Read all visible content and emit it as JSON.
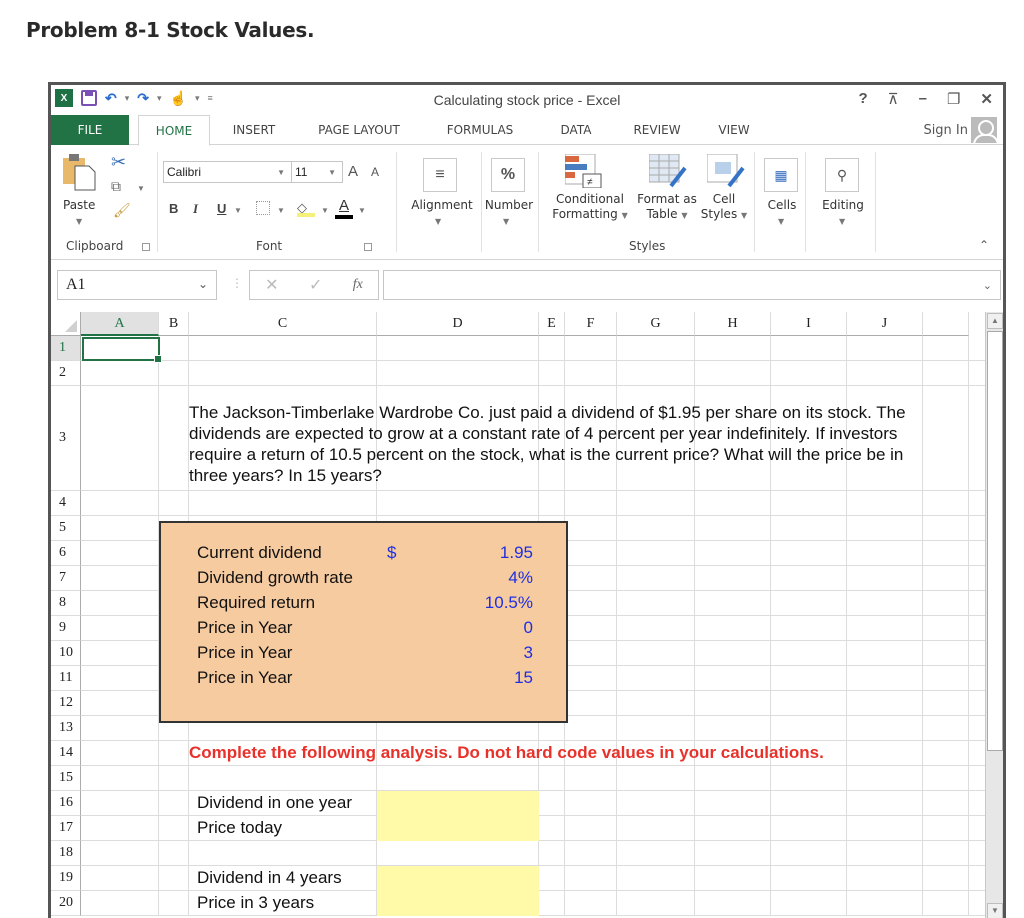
{
  "page_title": "Problem 8-1 Stock Values.",
  "window": {
    "title": "Calculating stock price - Excel",
    "controls": {
      "help": "?",
      "ribbon_display": "⊼",
      "minimize": "–",
      "restore": "❐",
      "close": "✕"
    },
    "qat": {
      "excel_logo": "X",
      "undo": "↶",
      "redo": "↷",
      "touch": "☝"
    }
  },
  "tabs": [
    {
      "label": "FILE"
    },
    {
      "label": "HOME"
    },
    {
      "label": "INSERT"
    },
    {
      "label": "PAGE LAYOUT"
    },
    {
      "label": "FORMULAS"
    },
    {
      "label": "DATA"
    },
    {
      "label": "REVIEW"
    },
    {
      "label": "VIEW"
    }
  ],
  "sign_in": "Sign In",
  "ribbon": {
    "clipboard": {
      "paste": "Paste",
      "group": "Clipboard"
    },
    "font": {
      "name": "Calibri",
      "size": "11",
      "bold": "B",
      "italic": "I",
      "underline": "U",
      "group": "Font",
      "grow": "A",
      "shrink": "A",
      "font_color": "A"
    },
    "alignment": "Alignment",
    "number": "Number",
    "number_icon": "%",
    "conditional_formatting": [
      "Conditional",
      "Formatting"
    ],
    "format_as_table": [
      "Format as",
      "Table"
    ],
    "cell_styles": [
      "Cell",
      "Styles"
    ],
    "styles_group": "Styles",
    "cells": "Cells",
    "editing": "Editing"
  },
  "formula_bar": {
    "name_box": "A1",
    "formula": "",
    "fx": "fx"
  },
  "columns": [
    "A",
    "B",
    "C",
    "D",
    "E",
    "F",
    "G",
    "H",
    "I",
    "J"
  ],
  "rows": [
    "1",
    "2",
    "3",
    "4",
    "5",
    "6",
    "7",
    "8",
    "9",
    "10",
    "11",
    "12",
    "13",
    "14",
    "15",
    "16",
    "17",
    "18",
    "19",
    "20"
  ],
  "sheet": {
    "problem_text": "The Jackson-Timberlake Wardrobe Co. just paid a dividend of $1.95 per share on its stock. The dividends are expected to grow at a constant rate of 4 percent per year indefinitely. If investors require a return of 10.5 percent on the stock, what is the current price? What will the price be in three years? In 15 years?",
    "inputs": [
      {
        "label": "Current dividend",
        "currency": "$",
        "value": "1.95"
      },
      {
        "label": "Dividend growth rate",
        "value": "4%"
      },
      {
        "label": "Required return",
        "value": "10.5%"
      },
      {
        "label": "Price in Year",
        "value": "0"
      },
      {
        "label": "Price in Year",
        "value": "3"
      },
      {
        "label": "Price in Year",
        "value": "15"
      }
    ],
    "instruction": "Complete the following analysis. Do not hard code values in your calculations.",
    "analysis": [
      {
        "label": "Dividend in one year",
        "value": ""
      },
      {
        "label": "Price today",
        "value": ""
      },
      {
        "label": "Dividend in 4 years",
        "value": ""
      },
      {
        "label": "Price in 3 years",
        "value": ""
      }
    ]
  },
  "colors": {
    "excel_green": "#217346",
    "input_fill": "#f7cba0",
    "answer_fill": "#fffaa8",
    "input_value": "#1e2fe0",
    "warning": "#e8312a"
  }
}
